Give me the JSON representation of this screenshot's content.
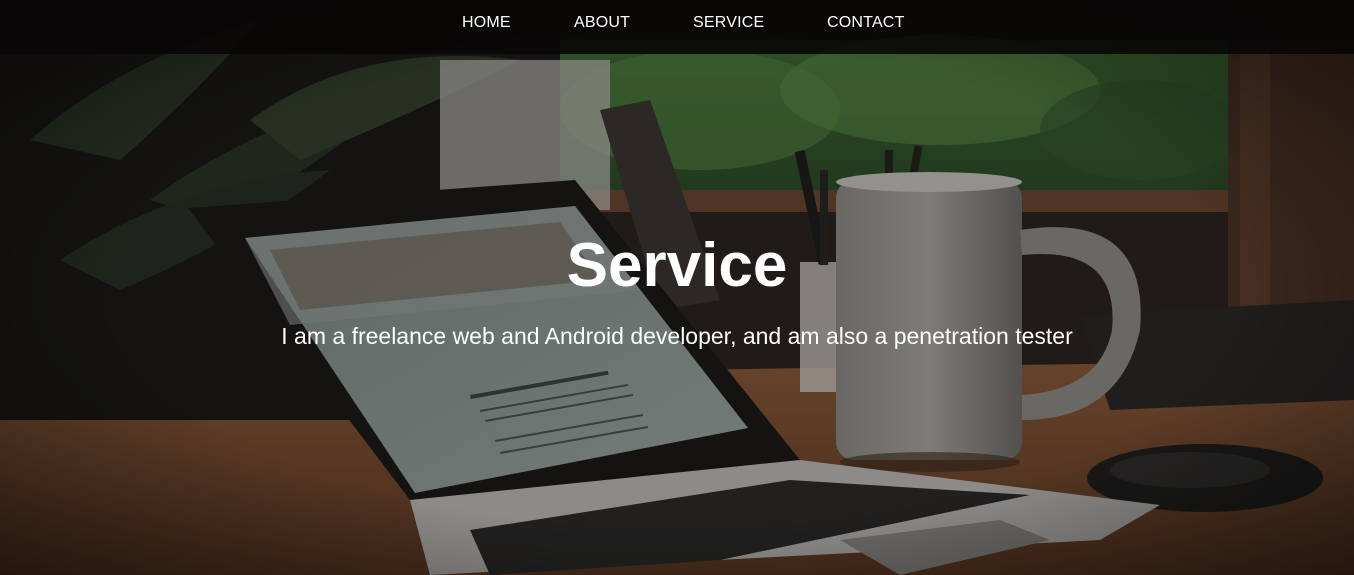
{
  "nav": {
    "items": [
      {
        "label": "HOME"
      },
      {
        "label": "ABOUT"
      },
      {
        "label": "SERVICE"
      },
      {
        "label": "CONTACT"
      }
    ]
  },
  "hero": {
    "title": "Service",
    "subtitle": "I am a freelance web and Android developer, and am also a penetration tester"
  },
  "colors": {
    "text": "#ffffff",
    "navbar_bg": "#0a0808"
  }
}
